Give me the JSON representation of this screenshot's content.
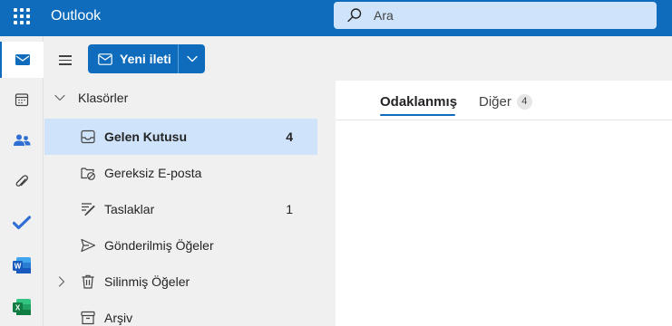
{
  "app": {
    "title": "Outlook"
  },
  "search": {
    "placeholder": "Ara"
  },
  "rail": {
    "items": [
      {
        "name": "mail",
        "icon": "mail-icon",
        "active": true
      },
      {
        "name": "calendar",
        "icon": "calendar-icon"
      },
      {
        "name": "people",
        "icon": "people-icon"
      },
      {
        "name": "files",
        "icon": "paperclip-icon"
      },
      {
        "name": "todo",
        "icon": "checkmark-icon"
      },
      {
        "name": "word",
        "icon": "word-icon"
      },
      {
        "name": "excel",
        "icon": "excel-icon"
      }
    ]
  },
  "toolbar": {
    "new_message_label": "Yeni ileti"
  },
  "folders": {
    "header": "Klasörler",
    "items": [
      {
        "label": "Gelen Kutusu",
        "count": "4",
        "icon": "inbox-icon",
        "selected": true
      },
      {
        "label": "Gereksiz E-posta",
        "count": "",
        "icon": "junk-icon"
      },
      {
        "label": "Taslaklar",
        "count": "1",
        "icon": "drafts-icon"
      },
      {
        "label": "Gönderilmiş Öğeler",
        "count": "",
        "icon": "send-icon"
      },
      {
        "label": "Silinmiş Öğeler",
        "count": "",
        "icon": "trash-icon"
      },
      {
        "label": "Arşiv",
        "count": "",
        "icon": "archive-icon"
      }
    ]
  },
  "message_list": {
    "tabs": [
      {
        "label": "Odaklanmış",
        "active": true
      },
      {
        "label": "Diğer",
        "badge": "4"
      }
    ]
  },
  "colors": {
    "brand": "#0f6cbd",
    "selected": "#cfe4fa",
    "search_bg": "#cfe4fa"
  }
}
